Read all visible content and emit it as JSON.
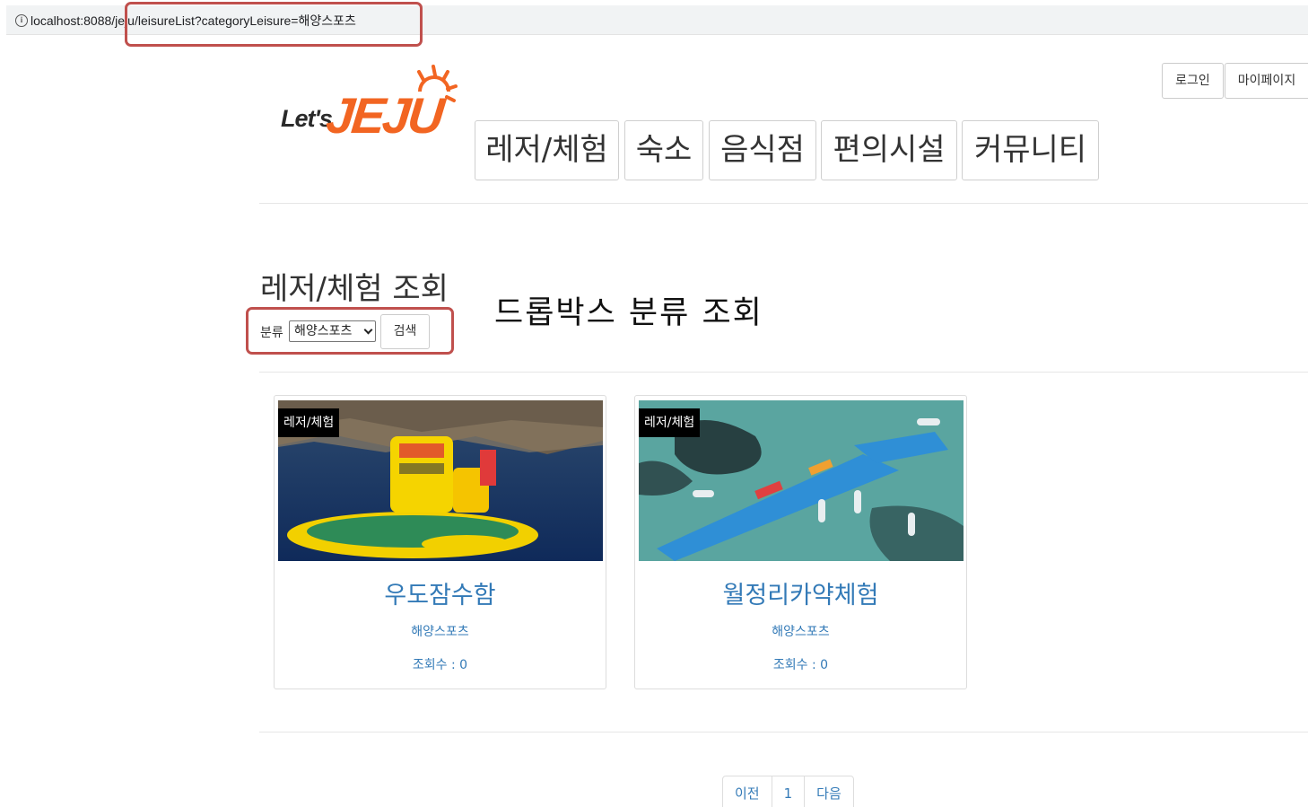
{
  "browser": {
    "url": "localhost:8088/jeju/leisureList?categoryLeisure=해양스포츠"
  },
  "header": {
    "logo_lets": "Let's",
    "logo_jeju": "JEJU",
    "login_label": "로그인",
    "mypage_label": "마이페이지",
    "nav": [
      "레저/체험",
      "숙소",
      "음식점",
      "편의시설",
      "커뮤니티"
    ]
  },
  "search": {
    "title": "레저/체험 조회",
    "filter_label": "분류",
    "selected_category": "해양스포츠",
    "search_button": "검색"
  },
  "annotation": {
    "text": "드롭박스 분류 조회",
    "highlight_color": "#c0504d"
  },
  "cards": [
    {
      "badge": "레저/체험",
      "title": "우도잠수함",
      "category": "해양스포츠",
      "views": "조회수 : 0"
    },
    {
      "badge": "레저/체험",
      "title": "월정리카약체험",
      "category": "해양스포츠",
      "views": "조회수 : 0"
    }
  ],
  "pagination": {
    "prev": "이전",
    "page": "1",
    "next": "다음"
  },
  "colors": {
    "link": "#337ab7",
    "logo_orange": "#f26522"
  }
}
